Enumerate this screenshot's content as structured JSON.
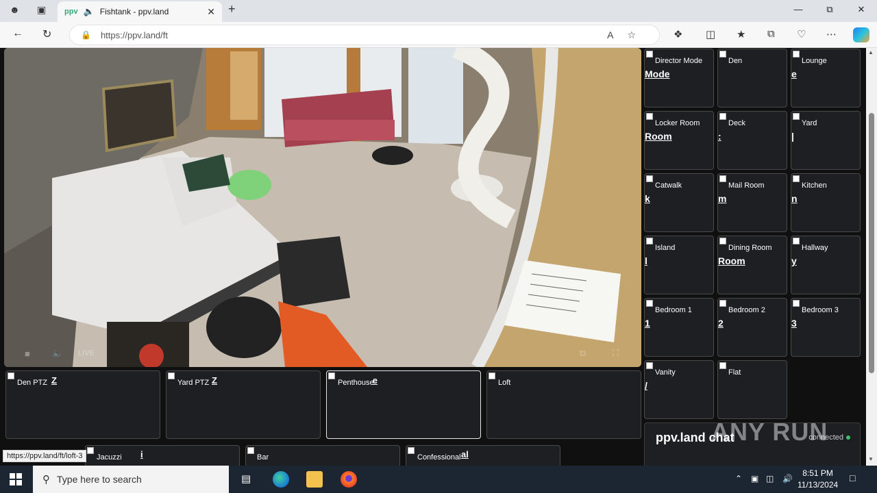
{
  "browser": {
    "tab_title": "Fishtank - ppv.land",
    "tab_favicon": "ppv",
    "url": "https://ppv.land/ft",
    "status_url": "https://ppv.land/ft/loft-3"
  },
  "side_cams": [
    {
      "label": "Director Mode",
      "ghost": "Mode"
    },
    {
      "label": "Den",
      "ghost": ""
    },
    {
      "label": "Lounge",
      "ghost": "e"
    },
    {
      "label": "Locker Room",
      "ghost": "Room"
    },
    {
      "label": "Deck",
      "ghost": ":"
    },
    {
      "label": "Yard",
      "ghost": "|"
    },
    {
      "label": "Catwalk",
      "ghost": "k"
    },
    {
      "label": "Mail Room",
      "ghost": "m"
    },
    {
      "label": "Kitchen",
      "ghost": "n"
    },
    {
      "label": "Island",
      "ghost": "l"
    },
    {
      "label": "Dining Room",
      "ghost": "Room"
    },
    {
      "label": "Hallway",
      "ghost": "y"
    },
    {
      "label": "Bedroom 1",
      "ghost": "1"
    },
    {
      "label": "Bedroom 2",
      "ghost": "2"
    },
    {
      "label": "Bedroom 3",
      "ghost": "3"
    },
    {
      "label": "Vanity",
      "ghost": "/"
    },
    {
      "label": "Flat",
      "ghost": ""
    }
  ],
  "bottom_cams": [
    {
      "label": "Den PTZ",
      "ghost": "Z"
    },
    {
      "label": "Yard PTZ",
      "ghost": "Z"
    },
    {
      "label": "Penthouse",
      "ghost": "e"
    },
    {
      "label": "Loft",
      "ghost": ""
    }
  ],
  "bottom_cams_row2": [
    {
      "label": "Jacuzzi",
      "ghost": "i"
    },
    {
      "label": "Bar",
      "ghost": ""
    },
    {
      "label": "Confessional",
      "ghost": "al"
    }
  ],
  "video": {
    "live_label": "LIVE"
  },
  "chat": {
    "title": "ppv.land chat",
    "status": "connected"
  },
  "watermark": "ANY RUN",
  "taskbar": {
    "search_placeholder": "Type here to search",
    "time": "8:51 PM",
    "date": "11/13/2024"
  }
}
